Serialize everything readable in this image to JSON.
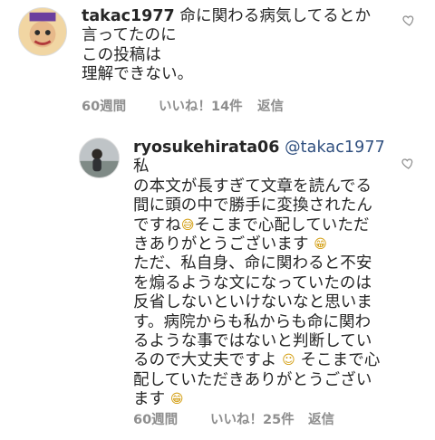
{
  "comments": [
    {
      "username": "takac1977",
      "text_lines": [
        "命に関わる病気してるとか",
        "言ってたのに",
        "この投稿は",
        "理解できない。"
      ],
      "time": "60週間",
      "likes": "いいね！14件",
      "reply_label": "返信",
      "avatar_icon": "cartoon-face-avatar"
    },
    {
      "username": "ryosukehirata06",
      "mention": "@takac1977",
      "text_lines": [
        "私",
        "の本文が長すぎて文章を読んでる",
        "間に頭の中で勝手に変換されたん",
        "ですね",
        "そこまで心配していただ",
        "きありがとうございます",
        "ただ、私自身、命に関わると不安",
        "を煽るような文になっていたのは",
        "反省しないといけないなと思いま",
        "す。病院からも私からも命に関わ",
        "るような事ではないと判断してい",
        "るので大丈夫ですよ",
        "そこまで心",
        "配していただきありがとうござい",
        "ます"
      ],
      "emojis": [
        "sweat-smile",
        "grin",
        "smile",
        "grin"
      ],
      "time": "60週間",
      "likes": "いいね！25件",
      "reply_label": "返信",
      "avatar_icon": "person-photo-avatar"
    }
  ],
  "colors": {
    "text": "#262626",
    "meta": "#8e8e8e",
    "mention": "#2f4f7f"
  },
  "icons": [
    "heart-outline-icon"
  ]
}
